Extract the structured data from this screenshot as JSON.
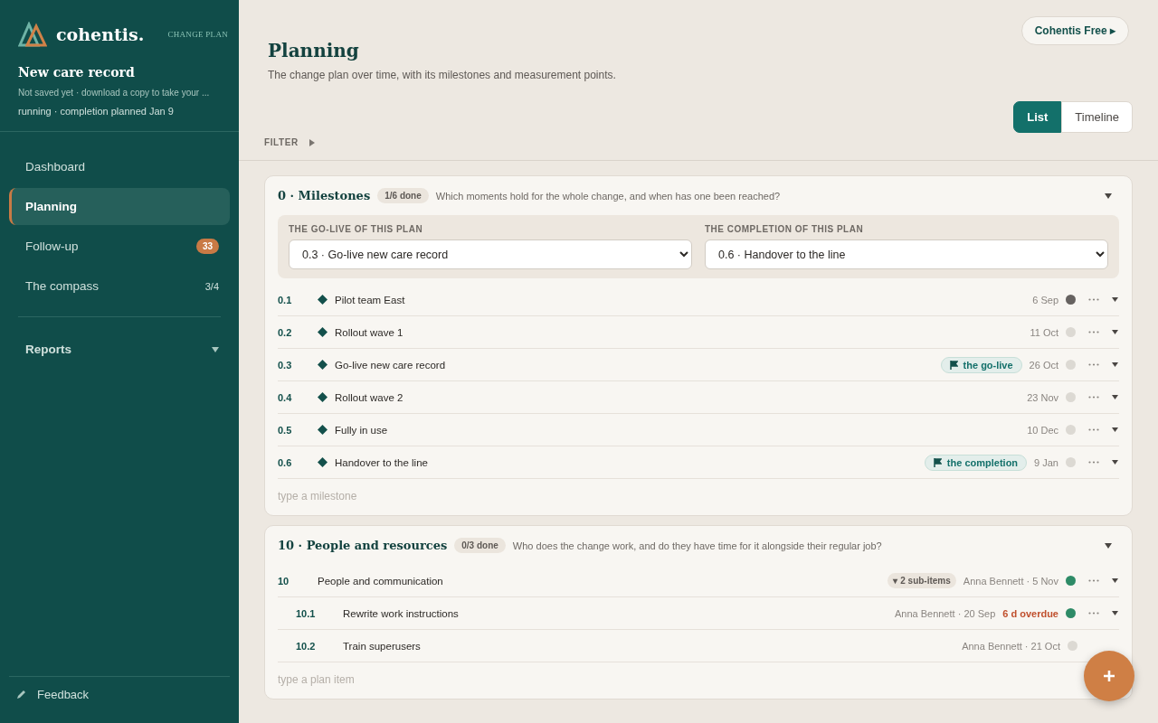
{
  "brand": {
    "name": "cohentis.",
    "plan_link": "CHANGE PLAN"
  },
  "record": {
    "title": "New care record",
    "note": "Not saved yet · download a copy to take your ...",
    "status": "running · completion planned Jan 9"
  },
  "nav": [
    {
      "label": "Dashboard",
      "selected": false
    },
    {
      "label": "Planning",
      "selected": true
    },
    {
      "label": "Follow-up",
      "selected": false,
      "badge": "33"
    },
    {
      "label": "The compass",
      "selected": false,
      "count": "3/4"
    }
  ],
  "reports": {
    "label": "Reports",
    "expanded": false
  },
  "feedback": "Feedback",
  "plan_button": "Cohentis Free ▸",
  "page": {
    "title": "Planning",
    "subtitle": "The change plan over time, with its milestones and measurement points."
  },
  "view_toggle": [
    {
      "label": "List",
      "selected": true
    },
    {
      "label": "Timeline",
      "selected": false
    }
  ],
  "filter": {
    "label": "FILTER",
    "expanded": false
  },
  "sections": [
    {
      "title": "0 · Milestones",
      "done": "1/6 done",
      "question": "Which moments hold for the whole change, and when has one been reached?",
      "expanded": true,
      "pickers": [
        {
          "label": "THE GO-LIVE OF THIS PLAN",
          "value": "0.3 · Go-live new care record"
        },
        {
          "label": "THE COMPLETION OF THIS PLAN",
          "value": "0.6 · Handover to the line"
        }
      ],
      "rows": [
        {
          "kind": "milestone",
          "num": "0.1",
          "name": "Pilot team East",
          "date": "6 Sep",
          "color": "#666260",
          "actions": true
        },
        {
          "kind": "milestone",
          "num": "0.2",
          "name": "Rollout wave 1",
          "date": "11 Oct",
          "color": "#dcd9d3",
          "actions": true
        },
        {
          "kind": "milestone",
          "num": "0.3",
          "name": "Go-live new care record",
          "tag": "the go-live",
          "date": "26 Oct",
          "color": "#dcd9d3",
          "actions": true
        },
        {
          "kind": "milestone",
          "num": "0.4",
          "name": "Rollout wave 2",
          "date": "23 Nov",
          "color": "#dcd9d3",
          "actions": true
        },
        {
          "kind": "milestone",
          "num": "0.5",
          "name": "Fully in use",
          "date": "10 Dec",
          "color": "#dcd9d3",
          "actions": true
        },
        {
          "kind": "milestone",
          "num": "0.6",
          "name": "Handover to the line",
          "tag": "the completion",
          "date": "9 Jan",
          "color": "#dcd9d3",
          "actions": true
        }
      ],
      "add_placeholder": "type a milestone"
    },
    {
      "title": "10 · People and resources",
      "done": "0/3 done",
      "question": "Who does the change work, and do they have time for it alongside their regular job?",
      "expanded": true,
      "rows": [
        {
          "kind": "item",
          "num": "10",
          "name": "People and communication",
          "subitems": "▾ 2 sub-items",
          "date": "Anna Bennett · 5 Nov",
          "color": "#2e8b67",
          "actions": true
        },
        {
          "kind": "subitem",
          "num": "10.1",
          "name": "Rewrite work instructions",
          "date": "Anna Bennett · 20 Sep",
          "overdue": "6 d overdue",
          "color": "#2e8b67",
          "actions": true
        },
        {
          "kind": "subitem",
          "num": "10.2",
          "name": "Train superusers",
          "date": "Anna Bennett · 21 Oct",
          "color": "#dcd9d3",
          "actions": false
        }
      ],
      "add_placeholder": "type a plan item"
    }
  ]
}
